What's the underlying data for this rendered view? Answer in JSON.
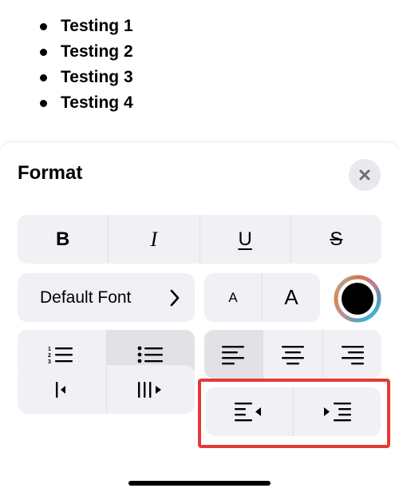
{
  "note": {
    "items": [
      "Testing 1",
      "Testing 2",
      "Testing 3",
      "Testing 4"
    ]
  },
  "format_sheet": {
    "title": "Format",
    "close_icon": "xmark-icon",
    "text_style": {
      "bold": "B",
      "italic": "I",
      "underline": "U",
      "strikethrough": "S"
    },
    "font_button_label": "Default Font",
    "size": {
      "decrease": "A",
      "increase": "A"
    },
    "color_wheel_icon": "color-picker-icon",
    "selected_list": "bulleted",
    "selected_alignment": "left",
    "highlight_color": "#e53935",
    "accent_background": "#f0f0f5"
  }
}
